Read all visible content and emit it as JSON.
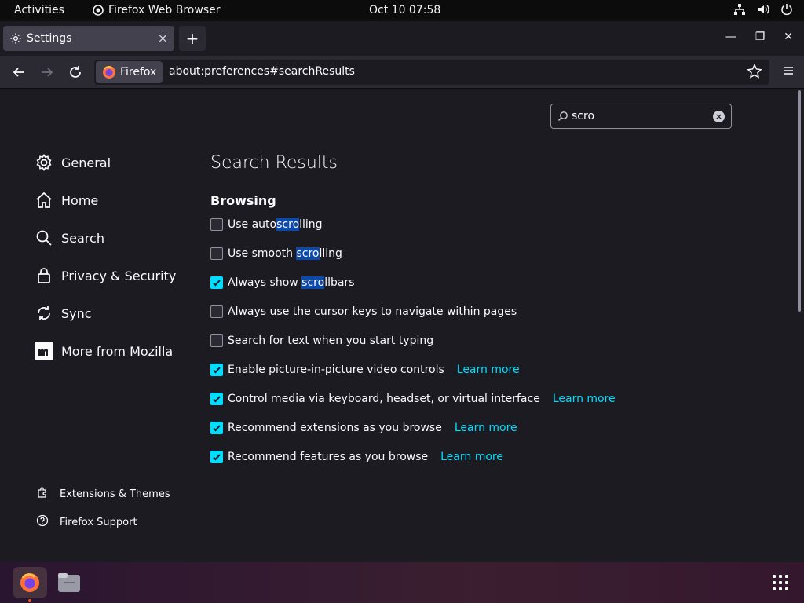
{
  "system": {
    "activities": "Activities",
    "app_name": "Firefox Web Browser",
    "clock": "Oct 10  07:58"
  },
  "tab": {
    "title": "Settings",
    "close": "×"
  },
  "newtab": "+",
  "urlbar": {
    "identity": "Firefox",
    "url": "about:preferences#searchResults"
  },
  "search": {
    "value": "scro"
  },
  "sidebar": {
    "categories": [
      {
        "label": "General",
        "icon": "gear-icon"
      },
      {
        "label": "Home",
        "icon": "home-icon"
      },
      {
        "label": "Search",
        "icon": "search-icon"
      },
      {
        "label": "Privacy & Security",
        "icon": "lock-icon"
      },
      {
        "label": "Sync",
        "icon": "sync-icon"
      },
      {
        "label": "More from Mozilla",
        "icon": "mozilla-icon"
      }
    ],
    "footer": [
      {
        "label": "Extensions & Themes",
        "icon": "puzzle-icon"
      },
      {
        "label": "Firefox Support",
        "icon": "help-icon"
      }
    ]
  },
  "main": {
    "heading": "Search Results",
    "section": "Browsing",
    "options": [
      {
        "pre": "Use auto",
        "hl": "scro",
        "post": "lling",
        "checked": false
      },
      {
        "pre": "Use smooth ",
        "hl": "scro",
        "post": "lling",
        "checked": false
      },
      {
        "pre": "Always show ",
        "hl": "scro",
        "post": "llbars",
        "checked": true
      },
      {
        "pre": "Always use the cursor keys to navigate within pages",
        "hl": "",
        "post": "",
        "checked": false
      },
      {
        "pre": "Search for text when you start typing",
        "hl": "",
        "post": "",
        "checked": false
      },
      {
        "pre": "Enable picture-in-picture video controls",
        "hl": "",
        "post": "",
        "checked": true,
        "learn": "Learn more"
      },
      {
        "pre": "Control media via keyboard, headset, or virtual interface",
        "hl": "",
        "post": "",
        "checked": true,
        "learn": "Learn more"
      },
      {
        "pre": "Recommend extensions as you browse",
        "hl": "",
        "post": "",
        "checked": true,
        "learn": "Learn more"
      },
      {
        "pre": "Recommend features as you browse",
        "hl": "",
        "post": "",
        "checked": true,
        "learn": "Learn more"
      }
    ]
  },
  "colors": {
    "accent": "#00ddff",
    "highlight": "#0b4aab",
    "background": "#1c1b22"
  }
}
